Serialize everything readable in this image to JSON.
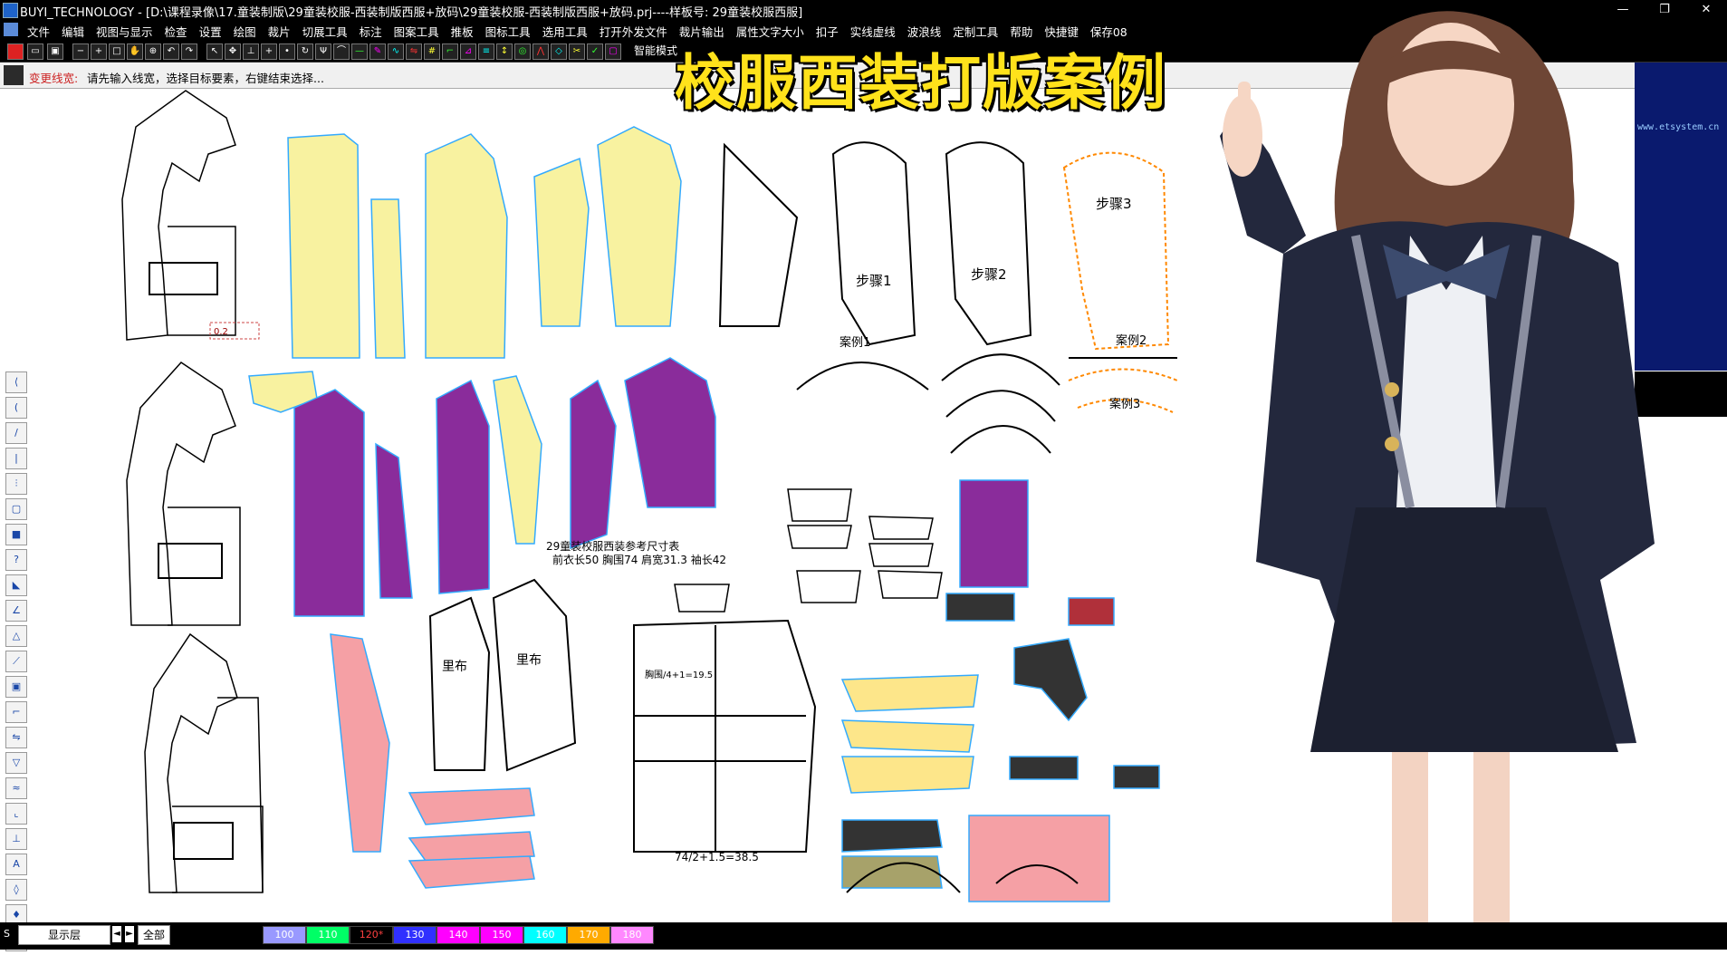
{
  "window": {
    "title": "BUYI_TECHNOLOGY - [D:\\课程录像\\17.童装制版\\29童装校服-西装制版西服+放码\\29童装校服-西装制版西服+放码.prj----样板号: 29童装校服西服]",
    "min": "—",
    "max": "❐",
    "close": "✕"
  },
  "menu": [
    "文件",
    "编辑",
    "视图与显示",
    "检查",
    "设置",
    "绘图",
    "裁片",
    "切展工具",
    "标注",
    "图案工具",
    "推板",
    "图标工具",
    "选用工具",
    "打开外发文件",
    "裁片输出",
    "属性文字大小",
    "扣子",
    "实线虚线",
    "波浪线",
    "定制工具",
    "帮助",
    "快捷键",
    "保存08"
  ],
  "toolbar": {
    "mode_label": "智能模式"
  },
  "status": {
    "label": "变更线宽:",
    "hint": "请先输入线宽，选择目标要素，右键结束选择..."
  },
  "overlay": {
    "heading": "校服西装打版案例"
  },
  "right_panel": {
    "site": "www.etsystem.cn"
  },
  "canvas": {
    "step1": "步骤1",
    "step2": "步骤2",
    "step3": "步骤3",
    "case1": "案例1",
    "case2": "案例2",
    "case3": "案例3",
    "lining1": "里布",
    "lining2": "里布",
    "specs_title": "29童装校服西装参考尺寸表",
    "specs_line": "前衣长50  胸围74  肩宽31.3  袖长42",
    "formula": "74/2+1.5=38.5",
    "chest_formula": "胸围/4+1=19.5",
    "note_label": "0.2"
  },
  "bottom": {
    "layer": "显示层",
    "all": "全部",
    "colors": [
      {
        "label": "100",
        "bg": "#9999ff"
      },
      {
        "label": "110",
        "bg": "#00ff66"
      },
      {
        "label": "120*",
        "bg": "#000000",
        "fg": "#ff4040"
      },
      {
        "label": "130",
        "bg": "#3030ff"
      },
      {
        "label": "140",
        "bg": "#ff00ff"
      },
      {
        "label": "150",
        "bg": "#ff00ff"
      },
      {
        "label": "160",
        "bg": "#00ffff"
      },
      {
        "label": "170",
        "bg": "#ffaa00"
      },
      {
        "label": "180",
        "bg": "#ff88ff"
      }
    ]
  }
}
